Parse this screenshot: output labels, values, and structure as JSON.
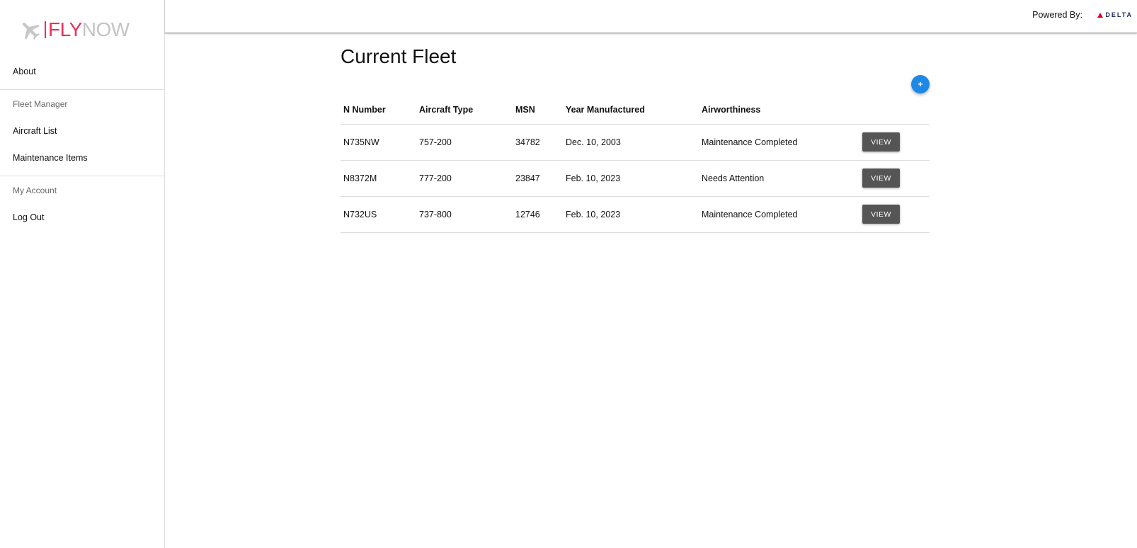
{
  "sidebar": {
    "logo": {
      "part1": "FLY",
      "part2": "NOW"
    },
    "about": "About",
    "fleet_manager_heading": "Fleet Manager",
    "aircraft_list": "Aircraft List",
    "maintenance_items": "Maintenance Items",
    "my_account_heading": "My Account",
    "log_out": "Log Out"
  },
  "header": {
    "powered_by": "Powered By:",
    "brand": "DELTA"
  },
  "main": {
    "title": "Current Fleet",
    "add_button": "+",
    "table": {
      "columns": [
        "N Number",
        "Aircraft Type",
        "MSN",
        "Year Manufactured",
        "Airworthiness",
        ""
      ],
      "rows": [
        {
          "n_number": "N735NW",
          "aircraft_type": "757-200",
          "msn": "34782",
          "year": "Dec. 10, 2003",
          "airworthiness": "Maintenance Completed",
          "status": "ok",
          "action": "VIEW"
        },
        {
          "n_number": "N8372M",
          "aircraft_type": "777-200",
          "msn": "23847",
          "year": "Feb. 10, 2023",
          "airworthiness": "Needs Attention",
          "status": "bad",
          "action": "VIEW"
        },
        {
          "n_number": "N732US",
          "aircraft_type": "737-800",
          "msn": "12746",
          "year": "Feb. 10, 2023",
          "airworthiness": "Maintenance Completed",
          "status": "ok",
          "action": "VIEW"
        }
      ]
    }
  },
  "colors": {
    "brand_pink": "#e8315b",
    "ok_green": "#1e9b3a",
    "attention_red": "#e53935",
    "fab_blue": "#1e88e5",
    "view_button": "#555555"
  }
}
